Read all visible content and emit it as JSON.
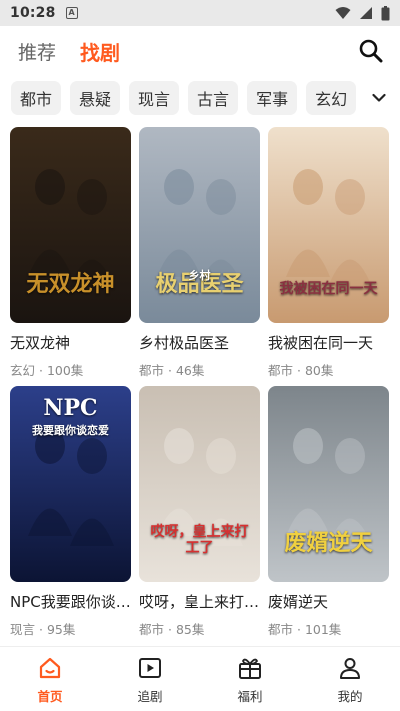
{
  "status": {
    "time": "10:28",
    "notif_glyph": "A"
  },
  "tabs": [
    {
      "label": "推荐",
      "active": false
    },
    {
      "label": "找剧",
      "active": true
    }
  ],
  "categories": [
    "都市",
    "悬疑",
    "现言",
    "古言",
    "军事",
    "玄幻"
  ],
  "dramas": [
    {
      "title": "无双龙神",
      "genre": "玄幻",
      "episodes": "100集",
      "poster_text": "无双龙神",
      "colors": [
        "#1a1410",
        "#3a2a1a",
        "#c8902a"
      ]
    },
    {
      "title": "乡村极品医圣",
      "genre": "都市",
      "episodes": "46集",
      "poster_text": "极品医圣",
      "poster_sub": "乡村",
      "colors": [
        "#7a8a9a",
        "#b0b8c2",
        "#e8d070"
      ]
    },
    {
      "title": "我被困在同一天",
      "genre": "都市",
      "episodes": "80集",
      "poster_text": "我被困在同一天",
      "colors": [
        "#c89a70",
        "#efe0cc",
        "#8a3040"
      ]
    },
    {
      "title": "NPC我要跟你谈恋爱",
      "genre": "现言",
      "episodes": "95集",
      "poster_text": "NPC",
      "poster_sub": "我要跟你谈恋爱",
      "colors": [
        "#0c1434",
        "#2c3f8a",
        "#ff4fa3"
      ]
    },
    {
      "title": "哎呀，皇上来打工了",
      "genre": "都市",
      "episodes": "85集",
      "poster_text": "哎呀，皇上来打工了",
      "colors": [
        "#e8e2da",
        "#c9bfb3",
        "#d63030"
      ]
    },
    {
      "title": "废婿逆天",
      "genre": "都市",
      "episodes": "101集",
      "poster_text": "废婿逆天",
      "colors": [
        "#bfc4c8",
        "#7d858b",
        "#f0d040"
      ]
    }
  ],
  "bottom_nav": [
    {
      "label": "首页",
      "icon": "home-icon",
      "active": true
    },
    {
      "label": "追剧",
      "icon": "play-icon",
      "active": false
    },
    {
      "label": "福利",
      "icon": "gift-icon",
      "active": false
    },
    {
      "label": "我的",
      "icon": "user-icon",
      "active": false
    }
  ],
  "accent_color": "#ff5a1f"
}
